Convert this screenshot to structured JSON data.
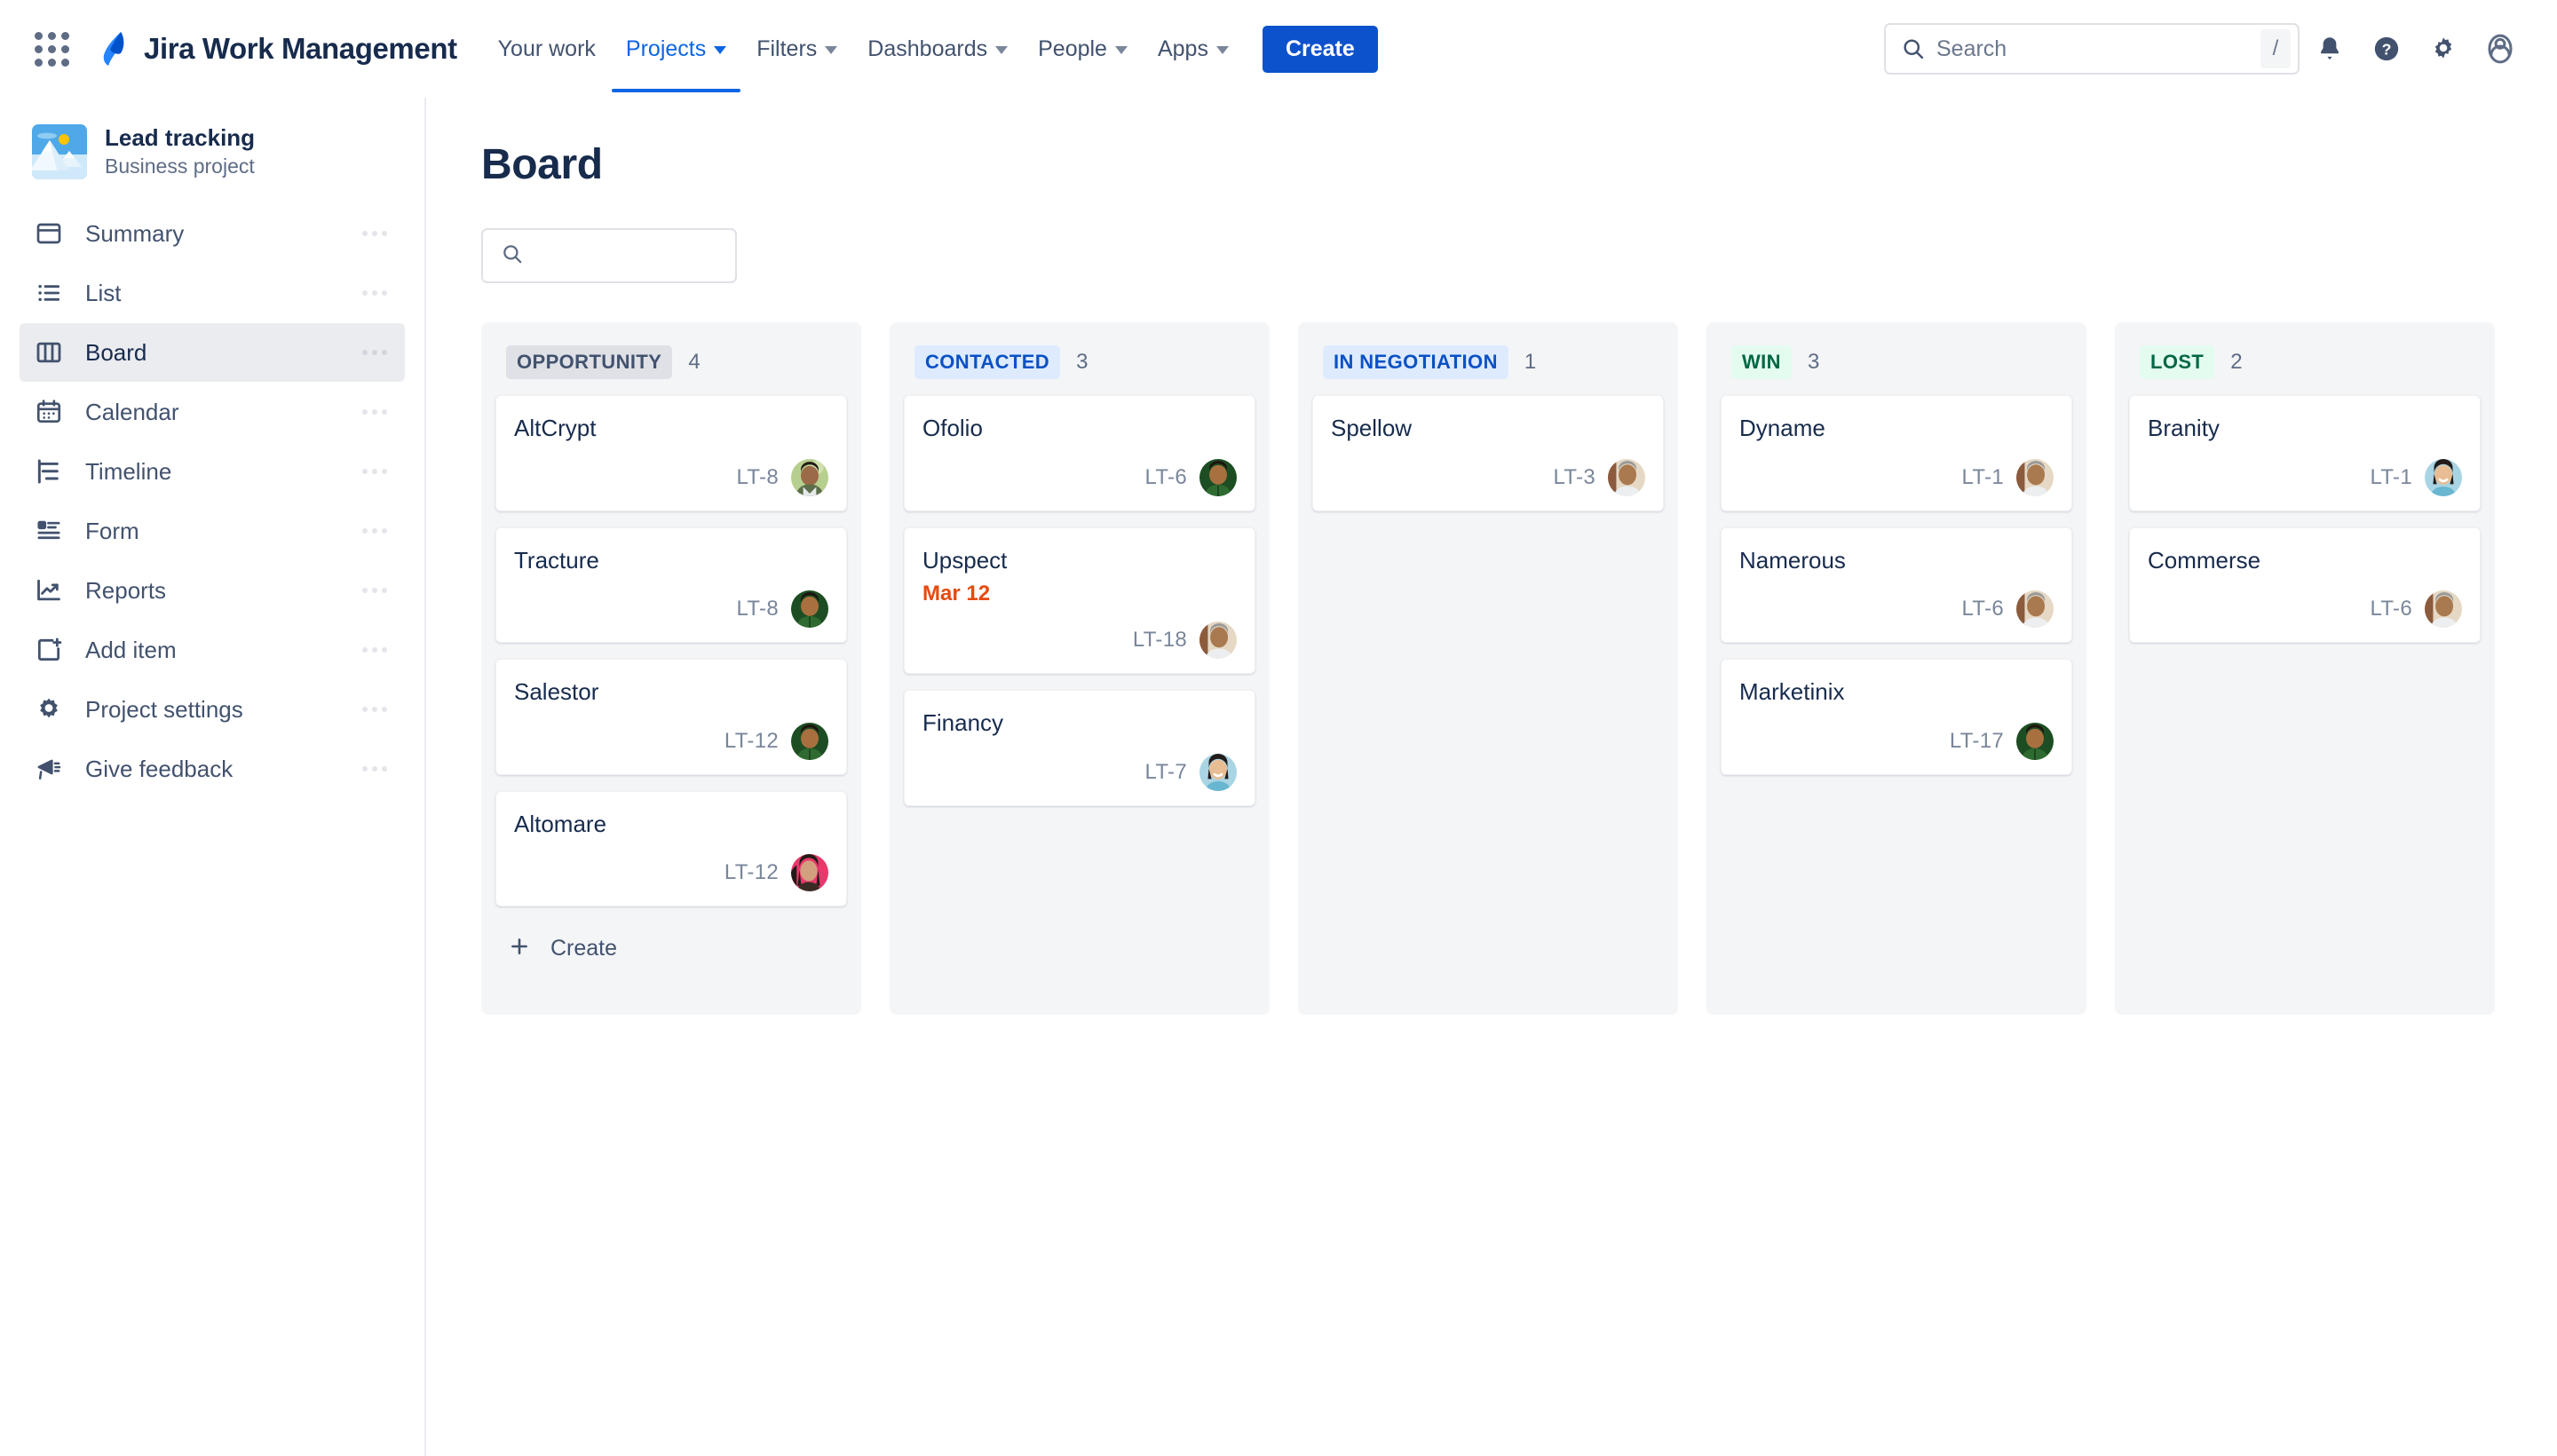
{
  "topnav": {
    "app_switcher_icon": "grid-apps-icon",
    "logo_icon": "jira-logo-icon",
    "product_name": "Jira Work Management",
    "links": [
      {
        "label": "Your work",
        "has_caret": false,
        "active": false
      },
      {
        "label": "Projects",
        "has_caret": true,
        "active": true
      },
      {
        "label": "Filters",
        "has_caret": true,
        "active": false
      },
      {
        "label": "Dashboards",
        "has_caret": true,
        "active": false
      },
      {
        "label": "People",
        "has_caret": true,
        "active": false
      },
      {
        "label": "Apps",
        "has_caret": true,
        "active": false
      }
    ],
    "create_label": "Create",
    "search": {
      "placeholder": "Search",
      "value": "",
      "shortcut": "/",
      "icon": "search-icon"
    },
    "icons": [
      {
        "name": "notifications-bell-icon"
      },
      {
        "name": "help-question-icon"
      },
      {
        "name": "settings-gear-icon"
      },
      {
        "name": "user-profile-avatar-icon"
      }
    ]
  },
  "sidebar": {
    "project": {
      "name": "Lead tracking",
      "type": "Business project",
      "avatar_icon": "mountain-landscape-icon"
    },
    "items": [
      {
        "label": "Summary",
        "icon": "summary-window-icon",
        "active": false
      },
      {
        "label": "List",
        "icon": "list-bullets-icon",
        "active": false
      },
      {
        "label": "Board",
        "icon": "board-columns-icon",
        "active": true
      },
      {
        "label": "Calendar",
        "icon": "calendar-icon",
        "active": false
      },
      {
        "label": "Timeline",
        "icon": "timeline-icon",
        "active": false
      },
      {
        "label": "Form",
        "icon": "form-icon",
        "active": false
      },
      {
        "label": "Reports",
        "icon": "reports-chart-icon",
        "active": false
      },
      {
        "label": "Add item",
        "icon": "add-item-plus-icon",
        "active": false
      },
      {
        "label": "Project settings",
        "icon": "gear-icon",
        "active": false
      },
      {
        "label": "Give feedback",
        "icon": "megaphone-icon",
        "active": false
      }
    ]
  },
  "main": {
    "title": "Board",
    "search": {
      "placeholder": "",
      "value": "",
      "icon": "search-icon"
    },
    "columns": [
      {
        "name": "OPPORTUNITY",
        "count": "4",
        "badge_style": "gray",
        "badge_bg": "#dfe1e6",
        "badge_fg": "#42526e",
        "create_label": "Create",
        "show_create": true,
        "cards": [
          {
            "title": "AltCrypt",
            "key": "LT-8",
            "due": "",
            "avatar": "a1"
          },
          {
            "title": "Tracture",
            "key": "LT-8",
            "due": "",
            "avatar": "a2"
          },
          {
            "title": "Salestor",
            "key": "LT-12",
            "due": "",
            "avatar": "a2"
          },
          {
            "title": "Altomare",
            "key": "LT-12",
            "due": "",
            "avatar": "a3"
          }
        ]
      },
      {
        "name": "CONTACTED",
        "count": "3",
        "badge_style": "blue",
        "badge_bg": "#deebff",
        "badge_fg": "#0b51c5",
        "create_label": "Create",
        "show_create": false,
        "cards": [
          {
            "title": "Ofolio",
            "key": "LT-6",
            "due": "",
            "avatar": "a2"
          },
          {
            "title": "Upspect",
            "key": "LT-18",
            "due": "Mar 12",
            "avatar": "a4"
          },
          {
            "title": "Financy",
            "key": "LT-7",
            "due": "",
            "avatar": "a5"
          }
        ]
      },
      {
        "name": "IN NEGOTIATION",
        "count": "1",
        "badge_style": "blue",
        "badge_bg": "#deebff",
        "badge_fg": "#0b51c5",
        "create_label": "Create",
        "show_create": false,
        "cards": [
          {
            "title": "Spellow",
            "key": "LT-3",
            "due": "",
            "avatar": "a4"
          }
        ]
      },
      {
        "name": "WIN",
        "count": "3",
        "badge_style": "green",
        "badge_bg": "#e3fcef",
        "badge_fg": "#006644",
        "create_label": "Create",
        "show_create": false,
        "cards": [
          {
            "title": "Dyname",
            "key": "LT-1",
            "due": "",
            "avatar": "a4"
          },
          {
            "title": "Namerous",
            "key": "LT-6",
            "due": "",
            "avatar": "a4"
          },
          {
            "title": "Marketinix",
            "key": "LT-17",
            "due": "",
            "avatar": "a2"
          }
        ]
      },
      {
        "name": "LOST",
        "count": "2",
        "badge_style": "green",
        "badge_bg": "#e3fcef",
        "badge_fg": "#006644",
        "create_label": "Create",
        "show_create": false,
        "cards": [
          {
            "title": "Branity",
            "key": "LT-1",
            "due": "",
            "avatar": "a5"
          },
          {
            "title": "Commerse",
            "key": "LT-6",
            "due": "",
            "avatar": "a4"
          }
        ]
      }
    ]
  },
  "colors": {
    "brand_blue": "#0c52cc",
    "link_blue": "#0c66e4",
    "text_primary": "#172b4d",
    "text_subtle": "#5e6c84",
    "due_red": "#e8490f",
    "column_bg": "#f4f5f7"
  }
}
